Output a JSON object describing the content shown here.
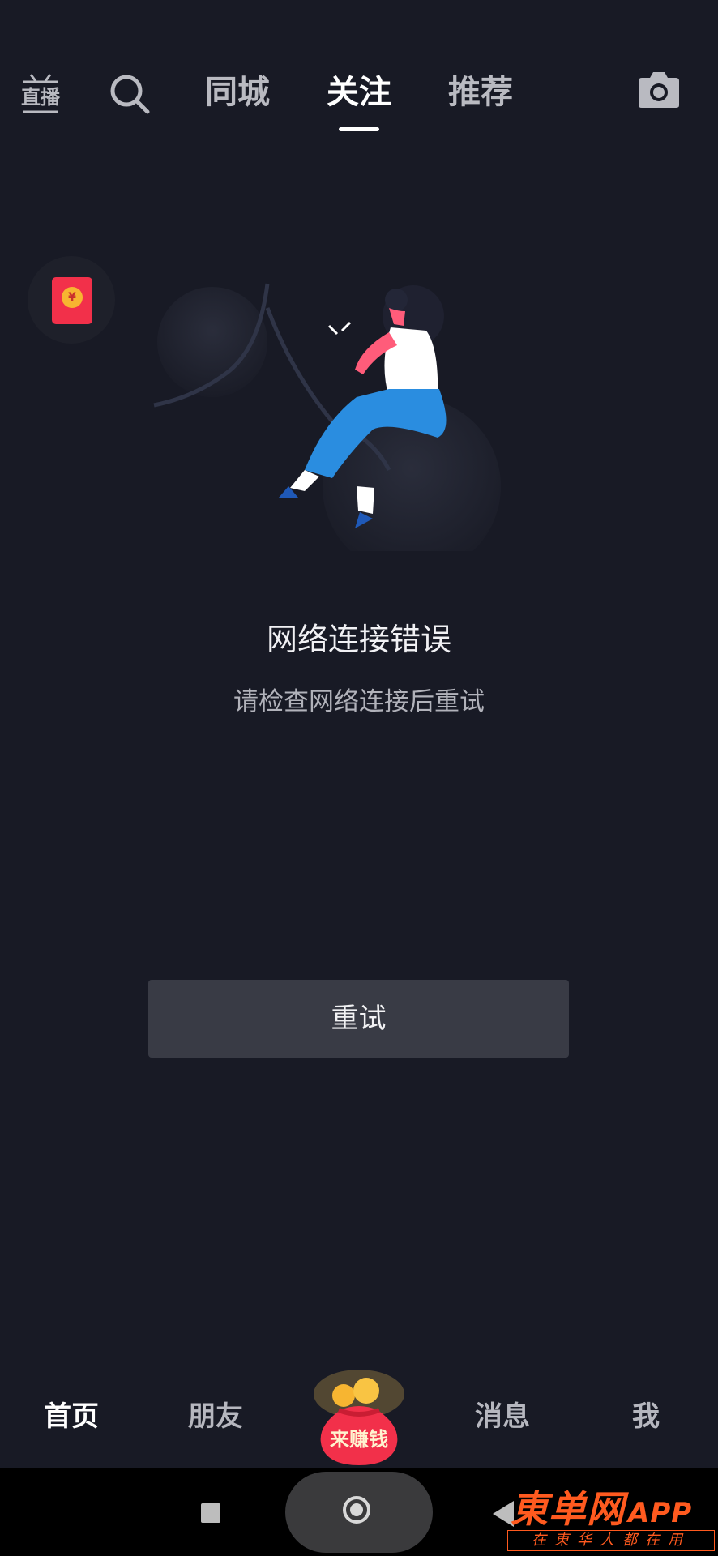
{
  "header": {
    "live_icon": "live-broadcast-icon",
    "live_label": "直播",
    "search_icon": "search-icon",
    "tabs": [
      {
        "label": "同城",
        "active": false
      },
      {
        "label": "关注",
        "active": true
      },
      {
        "label": "推荐",
        "active": false
      }
    ],
    "camera_icon": "camera-icon"
  },
  "floating": {
    "red_packet_icon": "red-packet-icon",
    "coin_symbol": "¥"
  },
  "error": {
    "title": "网络连接错误",
    "subtitle": "请检查网络连接后重试",
    "retry_label": "重试"
  },
  "bottom_nav": {
    "items": [
      {
        "label": "首页",
        "active": true
      },
      {
        "label": "朋友",
        "active": false
      },
      {
        "label": "来赚钱",
        "active": false
      },
      {
        "label": "消息",
        "active": false
      },
      {
        "label": "我",
        "active": false
      }
    ]
  },
  "watermark": {
    "brand": "東单网",
    "brand_suffix": "APP",
    "slogan": "在東华人都在用"
  },
  "colors": {
    "background": "#181a25",
    "button": "#393b45",
    "accent_red": "#f2304a",
    "watermark": "#ff5a1f"
  }
}
